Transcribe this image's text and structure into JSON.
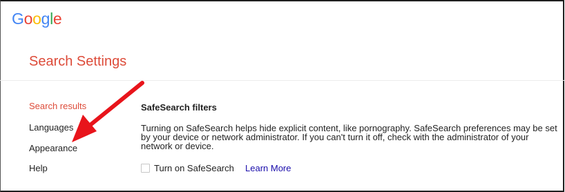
{
  "header": {
    "logo_letters": [
      {
        "char": "G",
        "color": "#4285F4"
      },
      {
        "char": "o",
        "color": "#EA4335"
      },
      {
        "char": "o",
        "color": "#FBBC05"
      },
      {
        "char": "g",
        "color": "#4285F4"
      },
      {
        "char": "l",
        "color": "#34A853"
      },
      {
        "char": "e",
        "color": "#EA4335"
      }
    ]
  },
  "page": {
    "title": "Search Settings"
  },
  "sidebar": {
    "items": [
      {
        "label": "Search results",
        "active": true
      },
      {
        "label": "Languages",
        "active": false
      },
      {
        "label": "Appearance",
        "active": false
      },
      {
        "label": "Help",
        "active": false
      }
    ]
  },
  "safesearch": {
    "title": "SafeSearch filters",
    "description": "Turning on SafeSearch helps hide explicit content, like pornography. SafeSearch preferences may be set by your device or network administrator. If you can't turn it off, check with the administrator of your network or device.",
    "checkbox_label": "Turn on SafeSearch",
    "checkbox_checked": false,
    "learn_more": "Learn More"
  },
  "colors": {
    "accent_red": "#dd4b39",
    "link_blue": "#1a0dab",
    "arrow_red": "#e8141b"
  }
}
